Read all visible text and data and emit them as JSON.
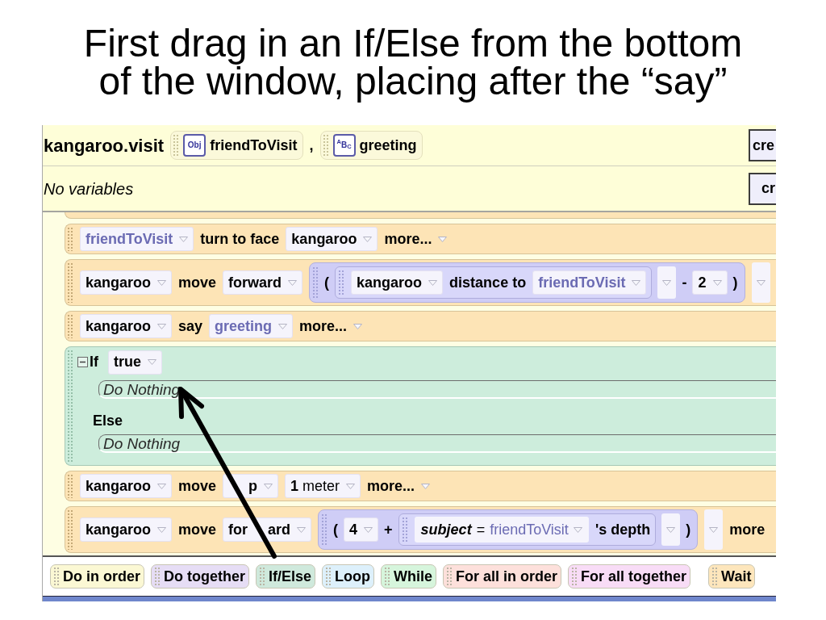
{
  "slide_title": "First drag in an If/Else from the bottom of the window, placing after the “say”",
  "method_header": {
    "name": "kangaroo.visit",
    "parameters": [
      {
        "type_badge": "Obj",
        "name": "friendToVisit"
      },
      {
        "type_badge": "$^{A}$B$_{C}$",
        "name": "greeting"
      }
    ],
    "separator": ",",
    "button": "cre"
  },
  "variables_bar": {
    "label": "No variables",
    "button": "cr"
  },
  "statements": [
    {
      "kind": "statement",
      "parts": [
        {
          "kind": "param_tile",
          "text": "friendToVisit"
        },
        {
          "kind": "word",
          "text": "turn to face"
        },
        {
          "kind": "object_tile",
          "text": "kangaroo"
        },
        {
          "kind": "option",
          "text": "more..."
        }
      ]
    },
    {
      "kind": "statement",
      "parts": [
        {
          "kind": "object_tile",
          "text": "kangaroo"
        },
        {
          "kind": "word",
          "text": "move"
        },
        {
          "kind": "object_tile",
          "text": "forward"
        },
        {
          "kind": "expression",
          "parts": [
            {
              "kind": "symbol",
              "text": "("
            },
            {
              "kind": "inner_block",
              "parts": [
                {
                  "kind": "object_tile",
                  "text": "kangaroo"
                },
                {
                  "kind": "word",
                  "text": "distance to"
                },
                {
                  "kind": "param_tile",
                  "text": "friendToVisit"
                }
              ]
            },
            {
              "kind": "caret_tile"
            },
            {
              "kind": "symbol",
              "text": "-"
            },
            {
              "kind": "object_tile",
              "text": "2"
            },
            {
              "kind": "symbol",
              "text": ")"
            }
          ]
        },
        {
          "kind": "caret_tile"
        }
      ]
    },
    {
      "kind": "statement",
      "parts": [
        {
          "kind": "object_tile",
          "text": "kangaroo"
        },
        {
          "kind": "word",
          "text": "say"
        },
        {
          "kind": "param_tile",
          "text": "greeting"
        },
        {
          "kind": "option",
          "text": "more..."
        }
      ]
    },
    {
      "kind": "if_else",
      "expanded": true,
      "if_label": "If",
      "condition": "true",
      "if_body": "Do Nothing",
      "else_label": "Else",
      "else_body": "Do Nothing"
    },
    {
      "kind": "statement",
      "parts": [
        {
          "kind": "object_tile",
          "text": "kangaroo"
        },
        {
          "kind": "word",
          "text": "move"
        },
        {
          "kind": "covered_tile",
          "segments": [
            "p"
          ]
        },
        {
          "kind": "value_tile",
          "text": "**1** meter"
        },
        {
          "kind": "option",
          "text": "more..."
        }
      ]
    },
    {
      "kind": "statement",
      "parts": [
        {
          "kind": "object_tile",
          "text": "kangaroo"
        },
        {
          "kind": "word",
          "text": "move"
        },
        {
          "kind": "covered_tile",
          "segments": [
            "for",
            "ard"
          ]
        },
        {
          "kind": "expression",
          "parts": [
            {
              "kind": "symbol",
              "text": "("
            },
            {
              "kind": "object_tile",
              "text": "4"
            },
            {
              "kind": "symbol",
              "text": "+"
            },
            {
              "kind": "inner_block",
              "parts": [
                {
                  "kind": "subject_tile",
                  "label": "subject",
                  "operator": "=",
                  "value": "friendToVisit"
                },
                {
                  "kind": "word",
                  "text": "'s depth"
                }
              ]
            },
            {
              "kind": "caret_tile"
            },
            {
              "kind": "symbol",
              "text": ")"
            }
          ]
        },
        {
          "kind": "caret_tile"
        },
        {
          "kind": "word",
          "text": "more"
        }
      ]
    }
  ],
  "palette": [
    {
      "kind": "block",
      "label": "Do in order",
      "color": "#fbf8d4"
    },
    {
      "kind": "block",
      "label": "Do together",
      "color": "#e6ddf5"
    },
    {
      "kind": "block",
      "label": "If/Else",
      "color": "#cfe9dc"
    },
    {
      "kind": "block",
      "label": "Loop",
      "color": "#ddf0fb"
    },
    {
      "kind": "block",
      "label": "While",
      "color": "#d6f5dc"
    },
    {
      "kind": "block",
      "label": "For all in order",
      "color": "#fde0db"
    },
    {
      "kind": "block",
      "label": "For all together",
      "color": "#f8dcf6"
    },
    {
      "kind": "spaced_block",
      "label": "Wait",
      "color": "#fde6bc"
    }
  ]
}
